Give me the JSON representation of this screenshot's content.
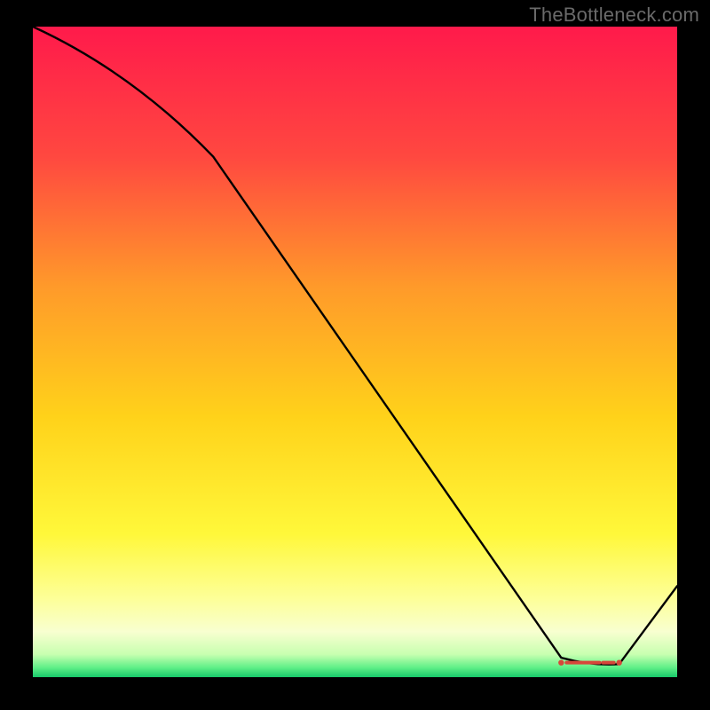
{
  "watermark": "TheBottleneck.com",
  "chart_data": {
    "type": "line",
    "title": "",
    "xlabel": "",
    "ylabel": "",
    "xlim": [
      0,
      100
    ],
    "ylim": [
      0,
      100
    ],
    "x": [
      0,
      28,
      82,
      91,
      100
    ],
    "values": [
      100,
      80,
      3,
      2,
      14
    ],
    "marker_region": {
      "x_start": 82,
      "x_end": 91,
      "approx_y": 2.5
    },
    "background_gradient": {
      "stops": [
        {
          "offset": 0.0,
          "color": "#ff1a4b"
        },
        {
          "offset": 0.2,
          "color": "#ff4840"
        },
        {
          "offset": 0.4,
          "color": "#ff9a2a"
        },
        {
          "offset": 0.6,
          "color": "#ffd21a"
        },
        {
          "offset": 0.78,
          "color": "#fff83a"
        },
        {
          "offset": 0.88,
          "color": "#fdff99"
        },
        {
          "offset": 0.93,
          "color": "#f8ffd0"
        },
        {
          "offset": 0.965,
          "color": "#c8ffb0"
        },
        {
          "offset": 0.985,
          "color": "#60f088"
        },
        {
          "offset": 1.0,
          "color": "#18c96a"
        }
      ]
    }
  }
}
